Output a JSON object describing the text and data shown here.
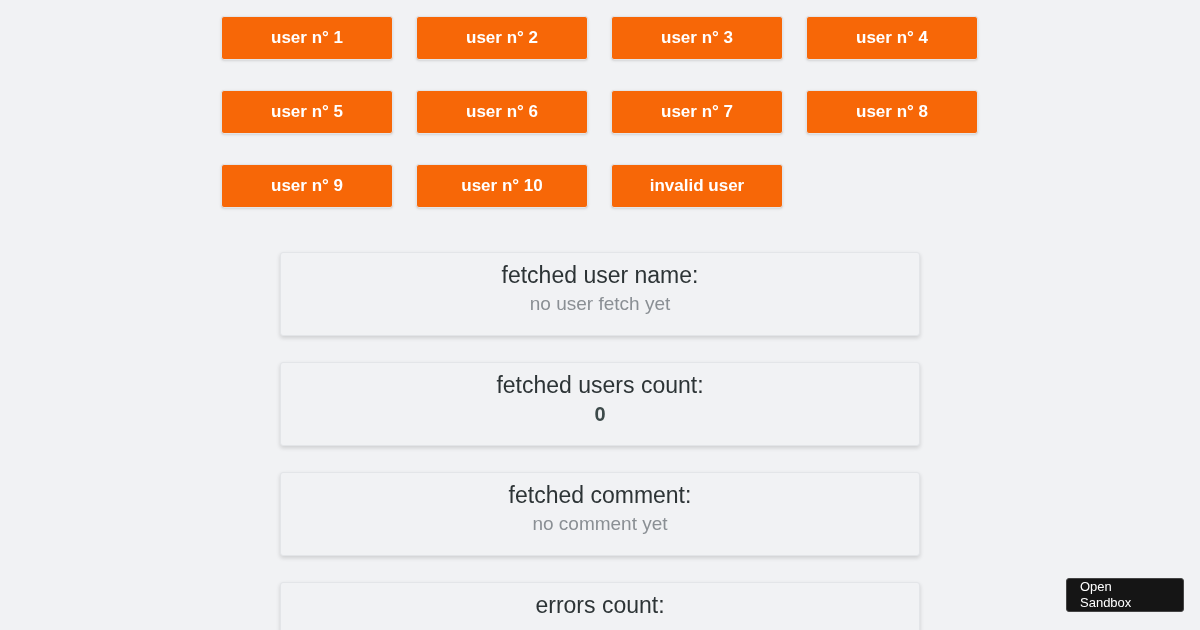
{
  "user_buttons": [
    {
      "label": "user n° 1"
    },
    {
      "label": "user n° 2"
    },
    {
      "label": "user n° 3"
    },
    {
      "label": "user n° 4"
    },
    {
      "label": "user n° 5"
    },
    {
      "label": "user n° 6"
    },
    {
      "label": "user n° 7"
    },
    {
      "label": "user n° 8"
    },
    {
      "label": "user n° 9"
    },
    {
      "label": "user n° 10"
    },
    {
      "label": "invalid user"
    }
  ],
  "cards": [
    {
      "title": "fetched user name:",
      "value": "no user fetch yet",
      "kind": "empty"
    },
    {
      "title": "fetched users count:",
      "value": "0",
      "kind": "number"
    },
    {
      "title": "fetched comment:",
      "value": "no comment yet",
      "kind": "empty"
    },
    {
      "title": "errors count:"
    }
  ],
  "sandbox_button": {
    "label": "Open Sandbox"
  }
}
